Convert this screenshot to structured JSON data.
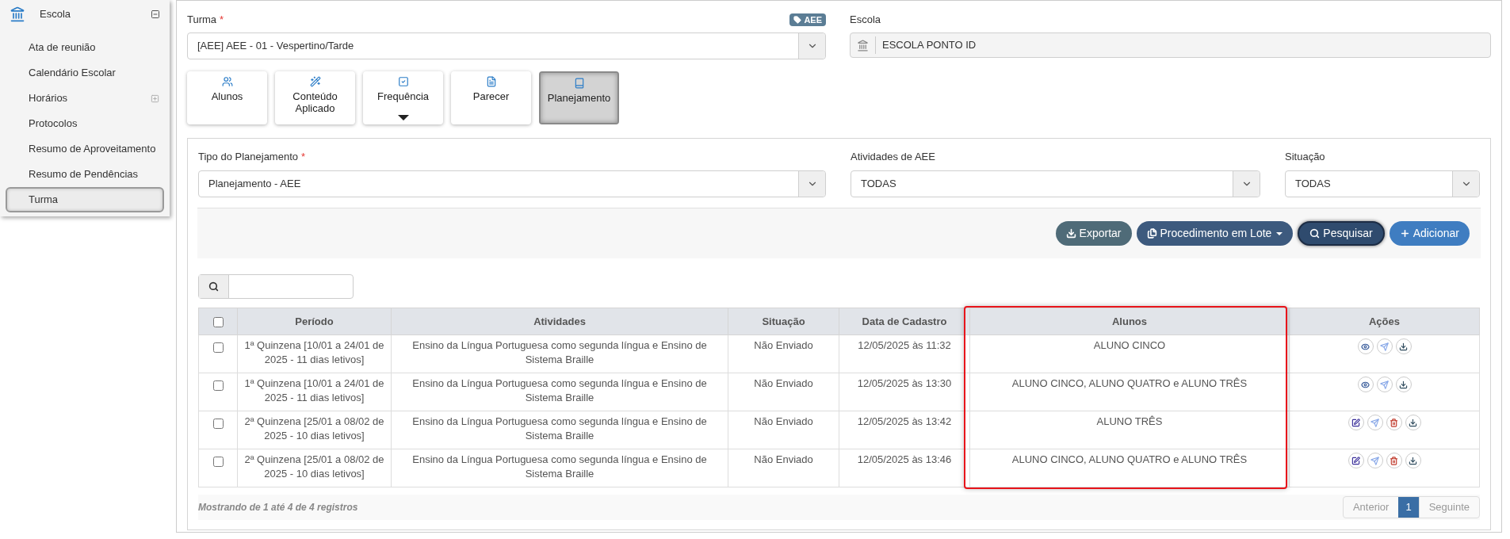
{
  "sidebar": {
    "title": "Escola",
    "expanded": true,
    "items": [
      {
        "label": "Ata de reunião",
        "expandable": false,
        "selected": false
      },
      {
        "label": "Calendário Escolar",
        "expandable": false,
        "selected": false
      },
      {
        "label": "Horários",
        "expandable": true,
        "selected": false
      },
      {
        "label": "Protocolos",
        "expandable": false,
        "selected": false
      },
      {
        "label": "Resumo de Aproveitamento",
        "expandable": false,
        "selected": false
      },
      {
        "label": "Resumo de Pendências",
        "expandable": false,
        "selected": false
      },
      {
        "label": "Turma",
        "expandable": false,
        "selected": true
      }
    ]
  },
  "turma": {
    "label": "Turma",
    "required_mark": "*",
    "badge": "AEE",
    "value": "[AEE]  AEE - 01 - Vespertino/Tarde"
  },
  "escola": {
    "label": "Escola",
    "value": "ESCOLA PONTO ID"
  },
  "tabs": [
    {
      "label": "Alunos",
      "kind": "users",
      "has_menu": false,
      "selected": false
    },
    {
      "label": "Conteúdo Aplicado",
      "kind": "wand",
      "has_menu": false,
      "selected": false
    },
    {
      "label": "Frequência",
      "kind": "check",
      "has_menu": true,
      "selected": false
    },
    {
      "label": "Parecer",
      "kind": "file",
      "has_menu": false,
      "selected": false
    },
    {
      "label": "Planejamento",
      "kind": "book",
      "has_menu": false,
      "selected": true
    }
  ],
  "filters": [
    {
      "label": "Tipo do Planejamento",
      "required_mark": "*",
      "value": "Planejamento - AEE"
    },
    {
      "label": "Atividades de AEE",
      "value": "TODAS"
    },
    {
      "label": "Situação",
      "value": "TODAS"
    }
  ],
  "actions": [
    {
      "label": "Exportar",
      "kind": "export",
      "focused": false
    },
    {
      "label": "Procedimento em Lote",
      "kind": "batch",
      "focused": false
    },
    {
      "label": "Pesquisar",
      "kind": "search",
      "focused": true
    },
    {
      "label": "Adicionar",
      "kind": "add",
      "focused": false
    }
  ],
  "table": {
    "columns": [
      "Período",
      "Atividades",
      "Situação",
      "Data de Cadastro",
      "Alunos",
      "Ações"
    ],
    "header_checked": false,
    "rows": [
      {
        "checked": false,
        "periodo": "1ª Quinzena [10/01 a 24/01 de 2025 - 11 dias letivos]",
        "atividades": "Ensino da Língua Portuguesa como segunda língua e Ensino de Sistema Braille",
        "situacao": "Não Enviado",
        "data": "12/05/2025 às 11:32",
        "alunos": "ALUNO CINCO",
        "actions": [
          {
            "kind": "view"
          },
          {
            "kind": "send"
          },
          {
            "kind": "download"
          }
        ]
      },
      {
        "checked": false,
        "periodo": "1ª Quinzena [10/01 a 24/01 de 2025 - 11 dias letivos]",
        "atividades": "Ensino da Língua Portuguesa como segunda língua e Ensino de Sistema Braille",
        "situacao": "Não Enviado",
        "data": "12/05/2025 às 13:30",
        "alunos": "ALUNO CINCO, ALUNO QUATRO e ALUNO TRÊS",
        "actions": [
          {
            "kind": "view"
          },
          {
            "kind": "send"
          },
          {
            "kind": "download"
          }
        ]
      },
      {
        "checked": false,
        "periodo": "2ª Quinzena [25/01 a 08/02 de 2025 - 10 dias letivos]",
        "atividades": "Ensino da Língua Portuguesa como segunda língua e Ensino de Sistema Braille",
        "situacao": "Não Enviado",
        "data": "12/05/2025 às 13:42",
        "alunos": "ALUNO TRÊS",
        "actions": [
          {
            "kind": "edit"
          },
          {
            "kind": "send"
          },
          {
            "kind": "delete"
          },
          {
            "kind": "download"
          }
        ]
      },
      {
        "checked": false,
        "periodo": "2ª Quinzena [25/01 a 08/02 de 2025 - 10 dias letivos]",
        "atividades": "Ensino da Língua Portuguesa como segunda língua e Ensino de Sistema Braille",
        "situacao": "Não Enviado",
        "data": "12/05/2025 às 13:46",
        "alunos": "ALUNO CINCO, ALUNO QUATRO e ALUNO TRÊS",
        "actions": [
          {
            "kind": "edit"
          },
          {
            "kind": "send"
          },
          {
            "kind": "delete"
          },
          {
            "kind": "download"
          }
        ]
      }
    ]
  },
  "footer": {
    "summary": "Mostrando de 1 até 4 de 4 registros",
    "previous": "Anterior",
    "pages": [
      {
        "label": "1",
        "selected": true
      }
    ],
    "next": "Seguinte"
  }
}
